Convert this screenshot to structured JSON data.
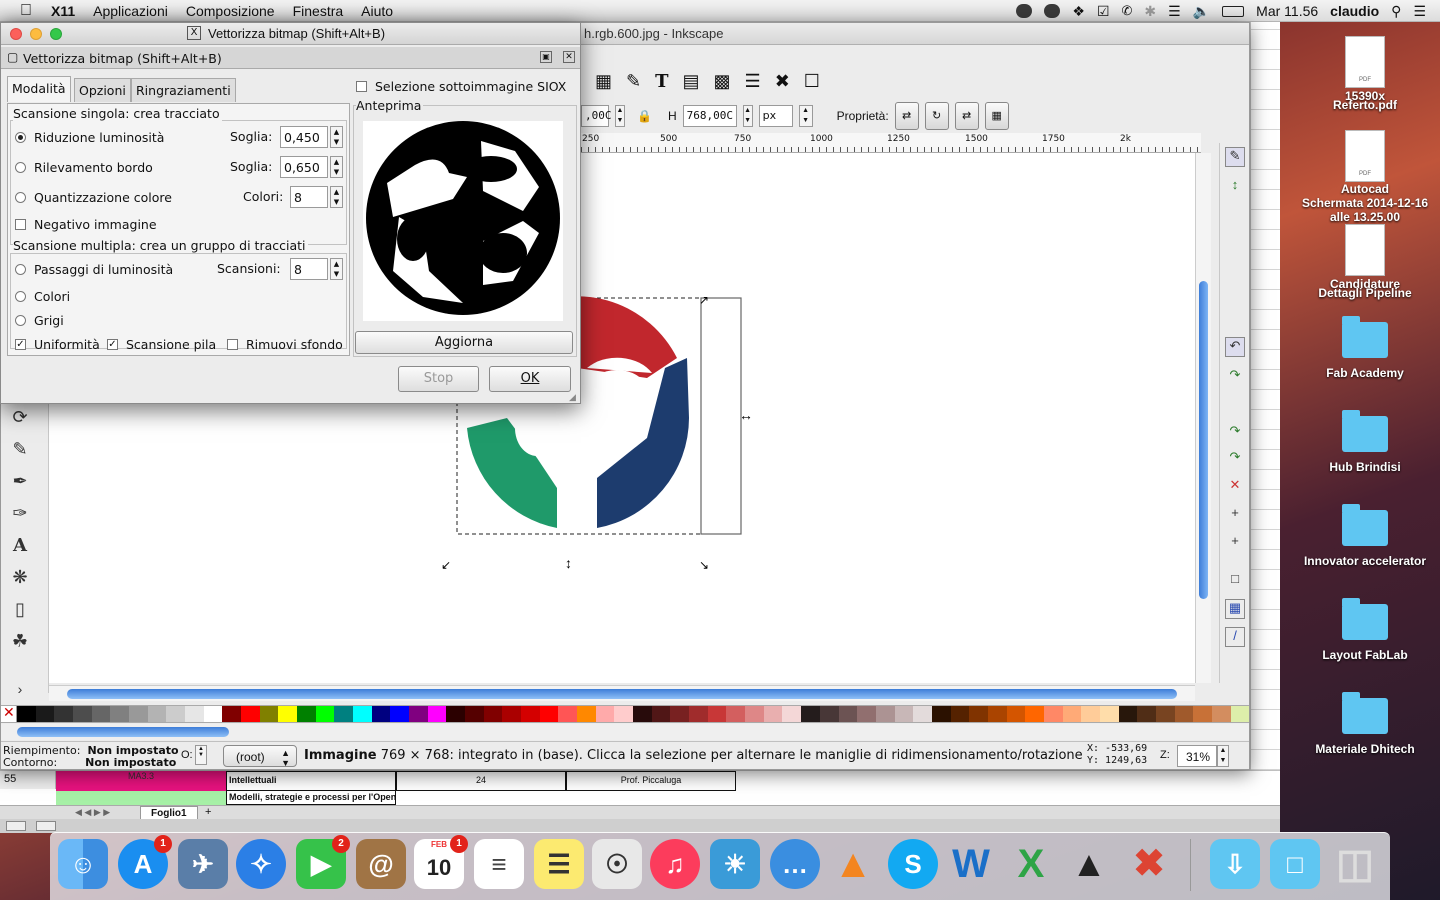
{
  "menubar": {
    "app": "X11",
    "items": [
      "Applicazioni",
      "Composizione",
      "Finestra",
      "Aiuto"
    ],
    "clock": "Mar 11.56",
    "user": "claudio"
  },
  "inkscape": {
    "title": "h.rgb.600.jpg - Inkscape",
    "w_value": ",00C",
    "h_label": "H",
    "h_value": "768,00C",
    "unit": "px",
    "props_label": "Proprietà:",
    "ruler_ticks": [
      "250",
      "500",
      "750",
      "1000",
      "1250",
      "1500",
      "1750",
      "2k"
    ],
    "status": {
      "fill_label": "Riempimento:",
      "fill_value": "Non impostato",
      "stroke_label": "Contorno:",
      "stroke_value": "Non impostato",
      "o_label": "O:",
      "layer": "(root)",
      "message_bold": "Immagine",
      "message": "769 × 768: integrato in (base). Clicca la selezione per alternare le maniglie di ridimensionamento/rotazione",
      "x": "X: -533,69",
      "y": "Y: 1249,63",
      "zoom_label": "Z:",
      "zoom": "31%"
    }
  },
  "dialog": {
    "title": "Vettorizza bitmap (Shift+Alt+B)",
    "subtitle": "Vettorizza bitmap (Shift+Alt+B)",
    "tabs": [
      "Modalità",
      "Opzioni",
      "Ringraziamenti"
    ],
    "single_scan_label": "Scansione singola: crea tracciato",
    "brightness": "Riduzione luminosità",
    "threshold_label": "Soglia:",
    "brightness_threshold": "0,450",
    "edge": "Rilevamento bordo",
    "edge_threshold": "0,650",
    "quant": "Quantizzazione colore",
    "colors_label": "Colori:",
    "colors_value": "8",
    "invert": "Negativo immagine",
    "multi_scan_label": "Scansione multipla: crea un gruppo di tracciati",
    "brightness_steps": "Passaggi di luminosità",
    "scans_label": "Scansioni:",
    "scans_value": "8",
    "multi_colors": "Colori",
    "greys": "Grigi",
    "smooth": "Uniformità",
    "stack": "Scansione pila",
    "remove_bg": "Rimuovi sfondo",
    "siox": "Selezione sottoimmagine SIOX",
    "preview_label": "Anteprima",
    "update_button": "Aggiorna",
    "stop_button": "Stop",
    "ok_button": "OK"
  },
  "sheet": {
    "row_number": "55",
    "cell_a": "MA3.3",
    "cell_b1": "Intellettuali",
    "cell_b2": "Modelli, strategie e processi per l'Open",
    "cell_c": "24",
    "cell_d": "Prof. Piccaluga",
    "sheet_tab": "Foglio1"
  },
  "desktop": {
    "icons": [
      {
        "label": "15390x\nReferto.pdf",
        "kind": "pdf"
      },
      {
        "label": "Autocad\nSchermata 2014-12-16\nalle 13.25.00",
        "kind": "pdf"
      },
      {
        "label": "Candidature\nDettagli Pipeline",
        "kind": "doc"
      },
      {
        "label": "Fab Academy",
        "kind": "folder"
      },
      {
        "label": "Hub Brindisi",
        "kind": "folder"
      },
      {
        "label": "Innovator accelerator",
        "kind": "folder"
      },
      {
        "label": "Layout FabLab",
        "kind": "folder"
      },
      {
        "label": "Materiale Dhitech",
        "kind": "folder"
      }
    ]
  },
  "dock": {
    "calendar_month": "FEB",
    "calendar_day": "10",
    "badges": {
      "appstore": "1",
      "facetime": "2",
      "calendar": "1"
    }
  },
  "colors": {
    "logo_red": "#c1272d",
    "logo_green": "#1f9a6a",
    "logo_blue": "#1d3c6e",
    "accent": "#3d7dd8"
  }
}
